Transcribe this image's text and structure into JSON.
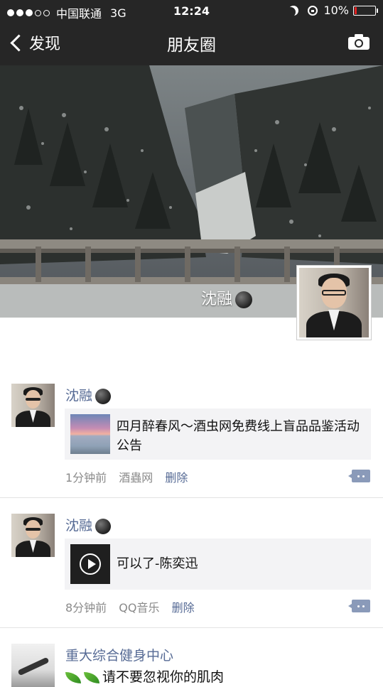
{
  "status_bar": {
    "carrier": "中国联通",
    "network": "3G",
    "time": "12:24",
    "battery": "10%"
  },
  "nav": {
    "back_label": "发现",
    "title": "朋友圈"
  },
  "cover": {
    "user_name": "沈融"
  },
  "posts": [
    {
      "author": "沈融",
      "content": "四月醉春风～酒虫网免费线上盲品品鉴活动公告",
      "time": "1分钟前",
      "source": "酒蟲网",
      "delete_label": "删除"
    },
    {
      "author": "沈融",
      "content": "可以了-陈奕迅",
      "time": "8分钟前",
      "source": "QQ音乐",
      "delete_label": "删除"
    },
    {
      "author": "重大综合健身中心",
      "content": "请不要忽视你的肌肉"
    }
  ],
  "colors": {
    "bar_bg": "#262626",
    "link_blue": "#576b95",
    "card_bg": "#f3f3f5"
  }
}
